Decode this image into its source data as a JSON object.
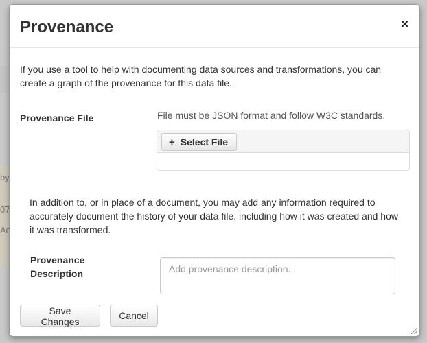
{
  "background": {
    "fragment_1": "by",
    "fragment_2": "07",
    "fragment_3": "Ad"
  },
  "modal": {
    "title": "Provenance",
    "close_symbol": "×",
    "intro": "If you use a tool to help with documenting data sources and transformations, you can create a graph of the provenance for this data file.",
    "provenance_file": {
      "label": "Provenance File",
      "help": "File must be JSON format and follow W3C standards.",
      "select_button": "Select File",
      "select_icon": "plus-icon"
    },
    "addition_text": "In addition to, or in place of a document, you may add any information required to accurately document the history of your data file, including how it was created and how it was transformed.",
    "description": {
      "label": "Provenance Description",
      "placeholder": "Add provenance description...",
      "value": ""
    },
    "buttons": {
      "save": "Save Changes",
      "cancel": "Cancel"
    }
  }
}
